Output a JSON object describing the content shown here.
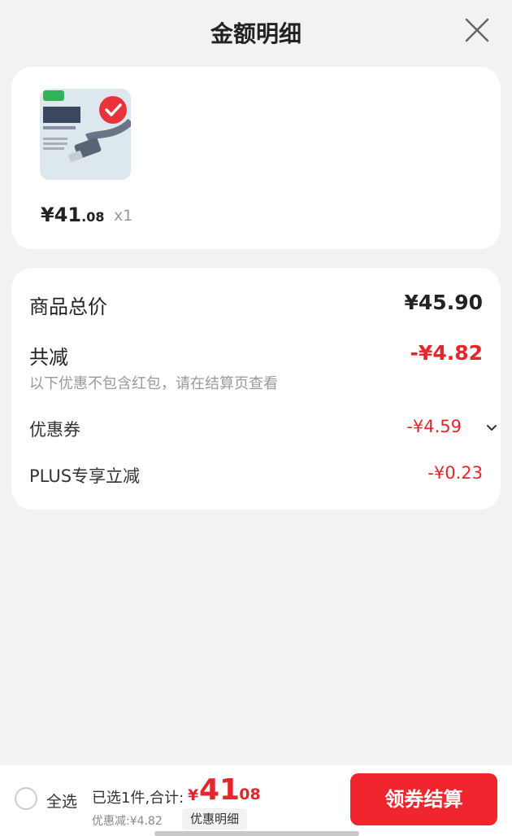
{
  "header": {
    "title": "金额明细",
    "close_icon": "close-icon"
  },
  "product": {
    "image_icon": "product-thumbnail-cable",
    "price_int": "¥41",
    "price_dec": ".08",
    "quantity": "x1"
  },
  "details": {
    "total_label": "商品总价",
    "total_value": "¥45.90",
    "reduce_label": "共减",
    "reduce_value": "-¥4.82",
    "note": "以下优惠不包含红包，请在结算页查看",
    "coupon_label": "优惠券",
    "coupon_value": "-¥4.59",
    "plus_label": "PLUS专享立减",
    "plus_value": "-¥0.23"
  },
  "footer": {
    "select_all": "全选",
    "selected_count": "已选1件,合计:",
    "sum_symbol": "¥",
    "sum_int": "41",
    "sum_dec": ".08",
    "discount": "优惠减:¥4.82",
    "detail_link": "优惠明细",
    "checkout": "领券结算"
  },
  "colors": {
    "accent": "#e4262d",
    "button": "#f0252e",
    "card": "#ffffff",
    "background": "#f2f2f2"
  }
}
